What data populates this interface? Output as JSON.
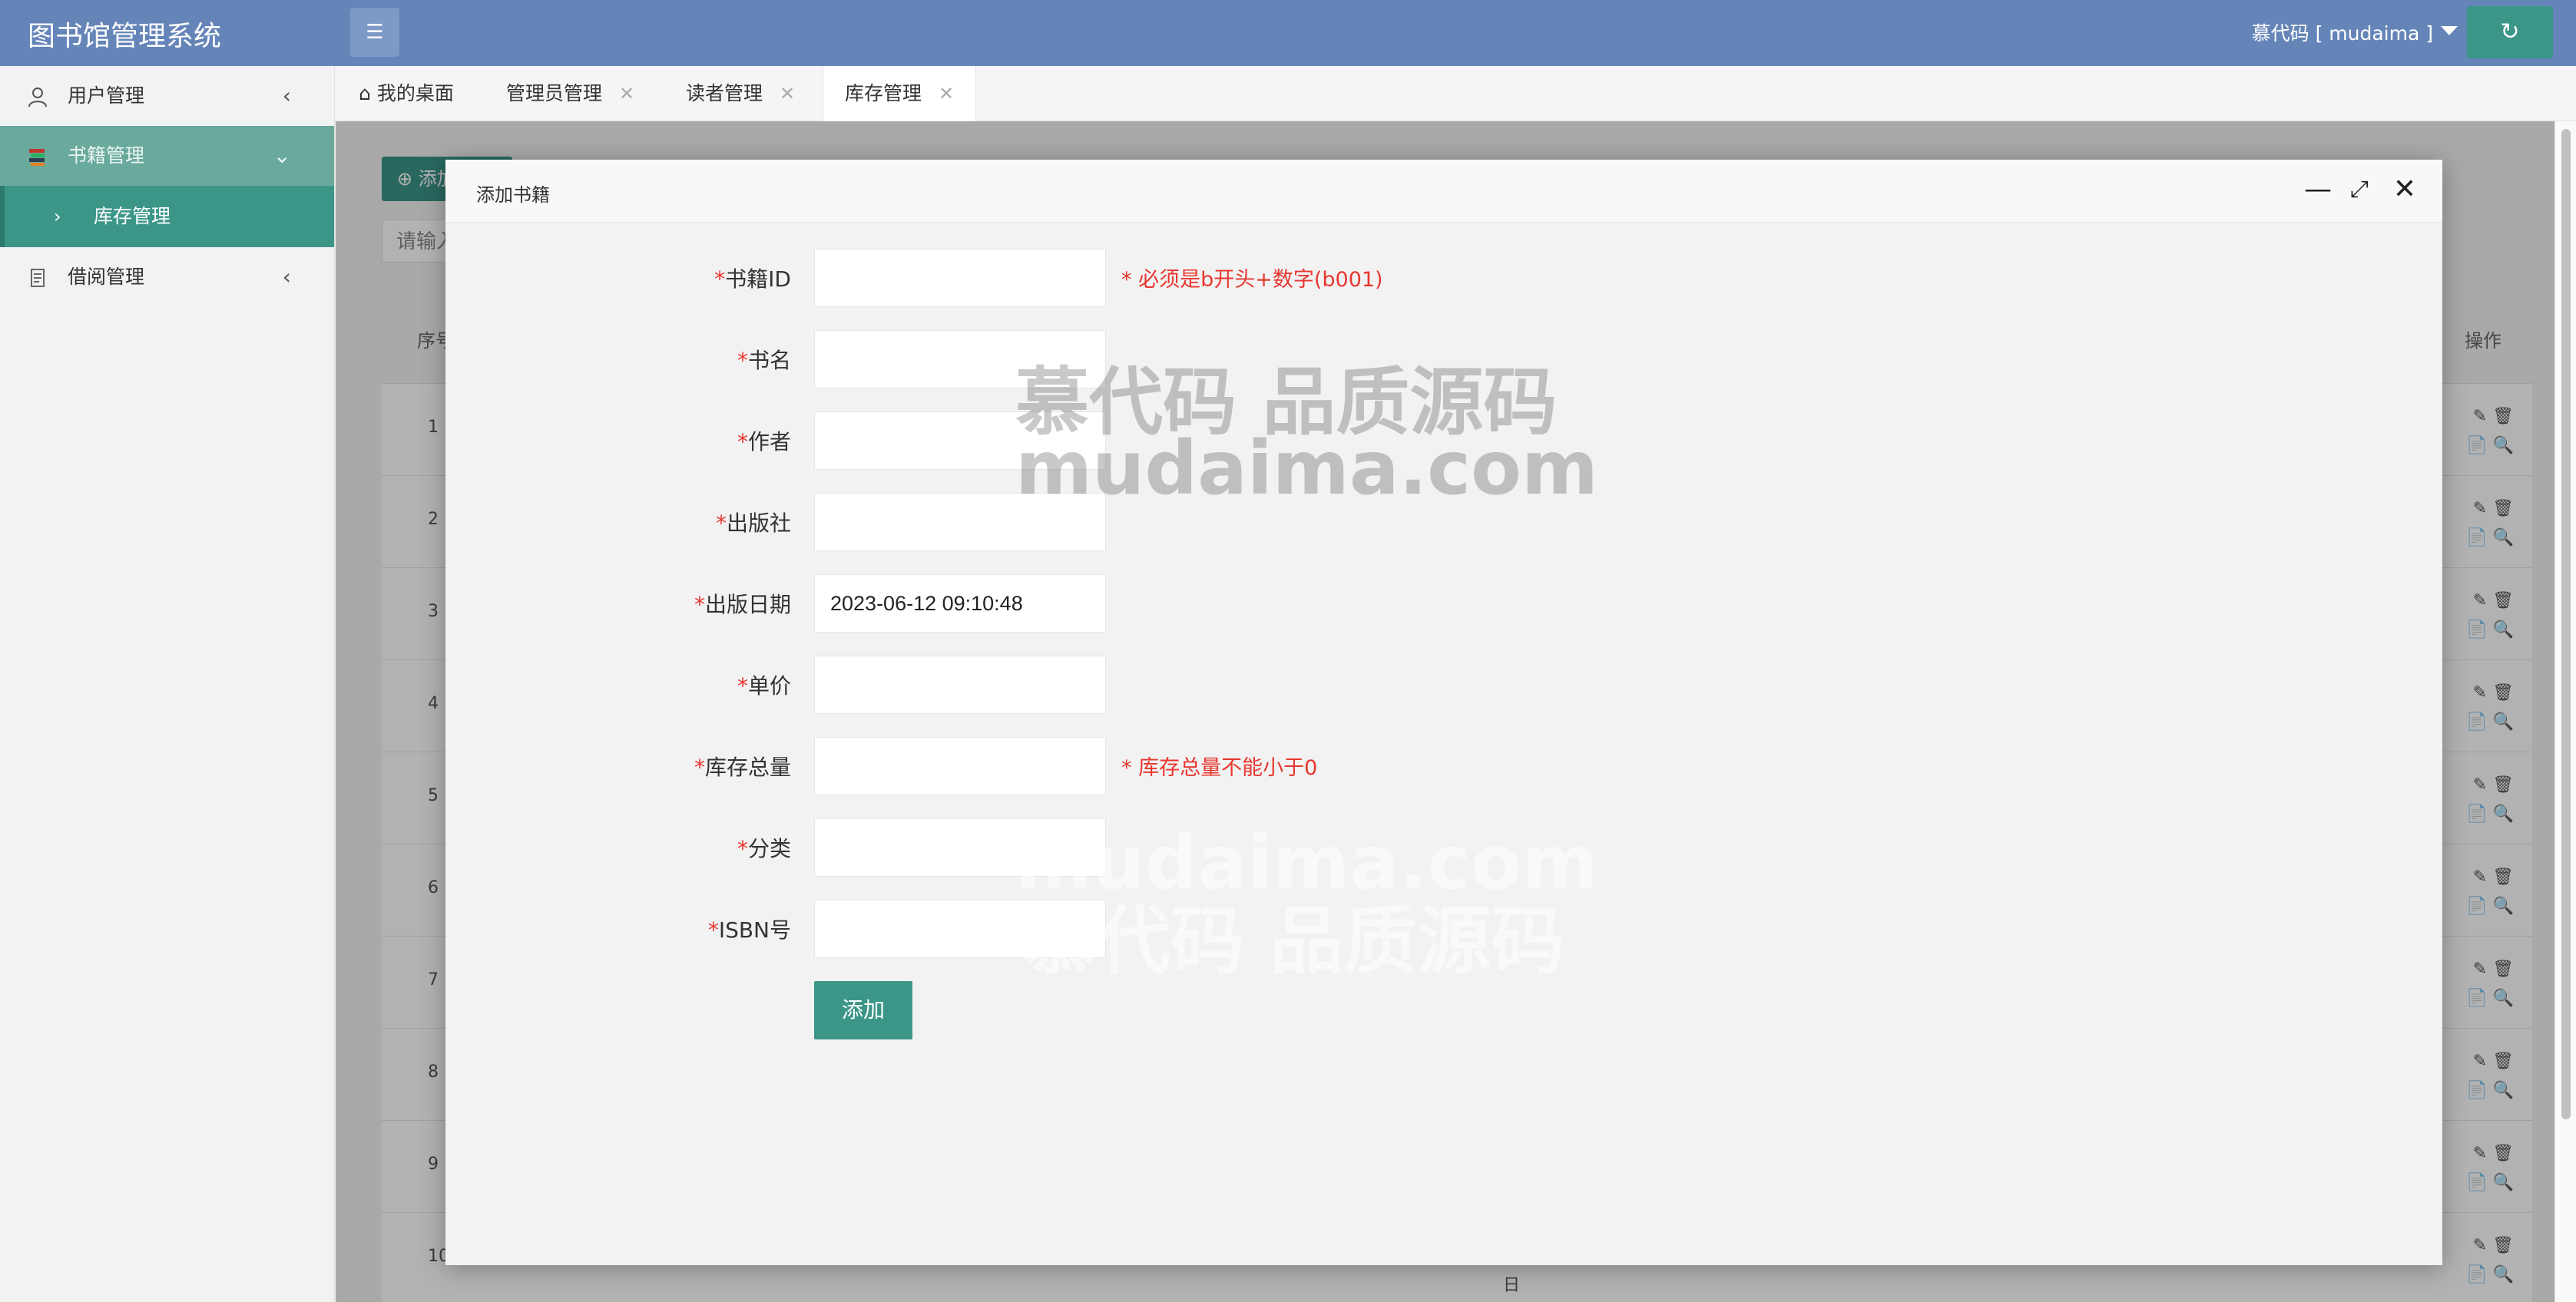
{
  "header": {
    "logo": "图书馆管理系统",
    "menu_icon": "list-icon",
    "user": "慕代码 [ mudaima ]",
    "refresh_icon": "refresh-icon"
  },
  "sidebar": {
    "items": [
      {
        "label": "用户管理",
        "icon": "user-icon"
      },
      {
        "label": "书籍管理",
        "icon": "books-icon"
      },
      {
        "label": "库存管理"
      },
      {
        "label": "借阅管理",
        "icon": "document-icon"
      }
    ]
  },
  "tabs": [
    {
      "label": "我的桌面",
      "icon": "home-icon"
    },
    {
      "label": "管理员管理"
    },
    {
      "label": "读者管理"
    },
    {
      "label": "库存管理"
    }
  ],
  "background": {
    "add_btn": "添加",
    "search_placeholder": "请输入",
    "col_index": "序号",
    "col_ops": "操作",
    "rows": [
      "1",
      "2",
      "3",
      "4",
      "5",
      "6",
      "7",
      "8",
      "9",
      "10"
    ],
    "row10_cell": "日"
  },
  "modal": {
    "title": "添加书籍",
    "required_mark": "*",
    "fields": [
      {
        "label": "书籍ID",
        "value": "",
        "tip": "* 必须是b开头+数字(b001)"
      },
      {
        "label": "书名",
        "value": ""
      },
      {
        "label": "作者",
        "value": ""
      },
      {
        "label": "出版社",
        "value": ""
      },
      {
        "label": "出版日期",
        "value": "2023-06-12 09:10:48"
      },
      {
        "label": "单价",
        "value": ""
      },
      {
        "label": "库存总量",
        "value": "",
        "tip": "* 库存总量不能小于0"
      },
      {
        "label": "分类",
        "value": ""
      },
      {
        "label": "ISBN号",
        "value": ""
      }
    ],
    "submit": "添加"
  },
  "watermark": {
    "line1": "慕代码 品质源码",
    "line2": "mudaima.com"
  }
}
